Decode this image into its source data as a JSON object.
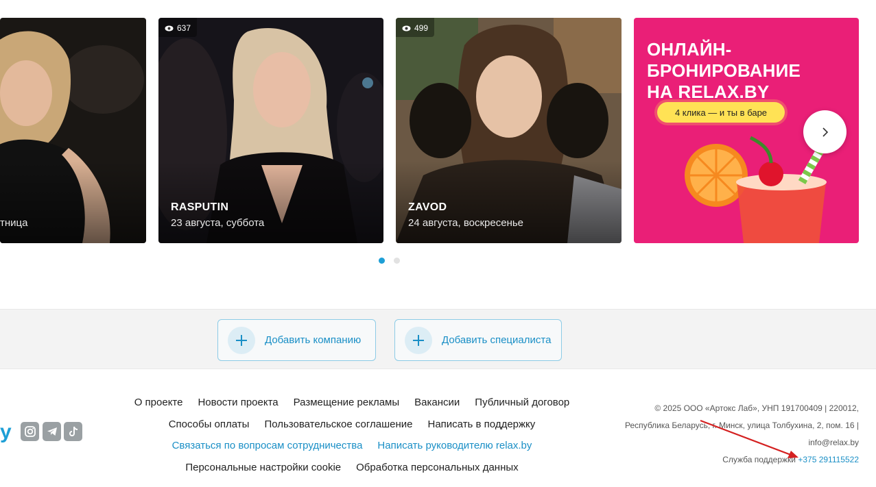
{
  "carousel": {
    "cards": [
      {
        "title": "",
        "date": "тница",
        "views": ""
      },
      {
        "title": "RASPUTIN",
        "date": "23 августа, суббота",
        "views": "637"
      },
      {
        "title": "ZAVOD",
        "date": "24 августа, воскресенье",
        "views": "499"
      }
    ],
    "promo": {
      "headline": "ОНЛАЙН-\nБРОНИРОВАНИЕ\nНА RELAX.BY",
      "pill": "4 клика — и ты в баре"
    },
    "next_icon": "chevron-right-icon"
  },
  "add_band": {
    "add_company": "Добавить компанию",
    "add_specialist": "Добавить специалиста"
  },
  "footer": {
    "logo_fragment": "y",
    "social": [
      "instagram-icon",
      "telegram-icon",
      "tiktok-icon"
    ],
    "links_row1": [
      "О проекте",
      "Новости проекта",
      "Размещение рекламы",
      "Вакансии",
      "Публичный договор"
    ],
    "links_row2": [
      "Способы оплаты",
      "Пользовательское соглашение",
      "Написать в поддержку"
    ],
    "links_row3": [
      "Связаться по вопросам сотрудничества",
      "Написать руководителю relax.by"
    ],
    "links_row4": [
      "Персональные настройки cookie",
      "Обработка персональных данных"
    ],
    "legal_line1": "© 2025 ООО «Артокс Лаб», УНП 191700409 | 220012,",
    "legal_line2": "Республика Беларусь, г. Минск, улица Толбухина, 2, пом. 16 |",
    "legal_line3": "info@relax.by",
    "support_label": "Служба поддержки",
    "support_phone": "+375 291115522"
  },
  "colors": {
    "accent": "#1a8fc6",
    "promo_bg": "#ea1f77",
    "pill": "#ffe255",
    "annotation_arrow": "#d42020"
  }
}
